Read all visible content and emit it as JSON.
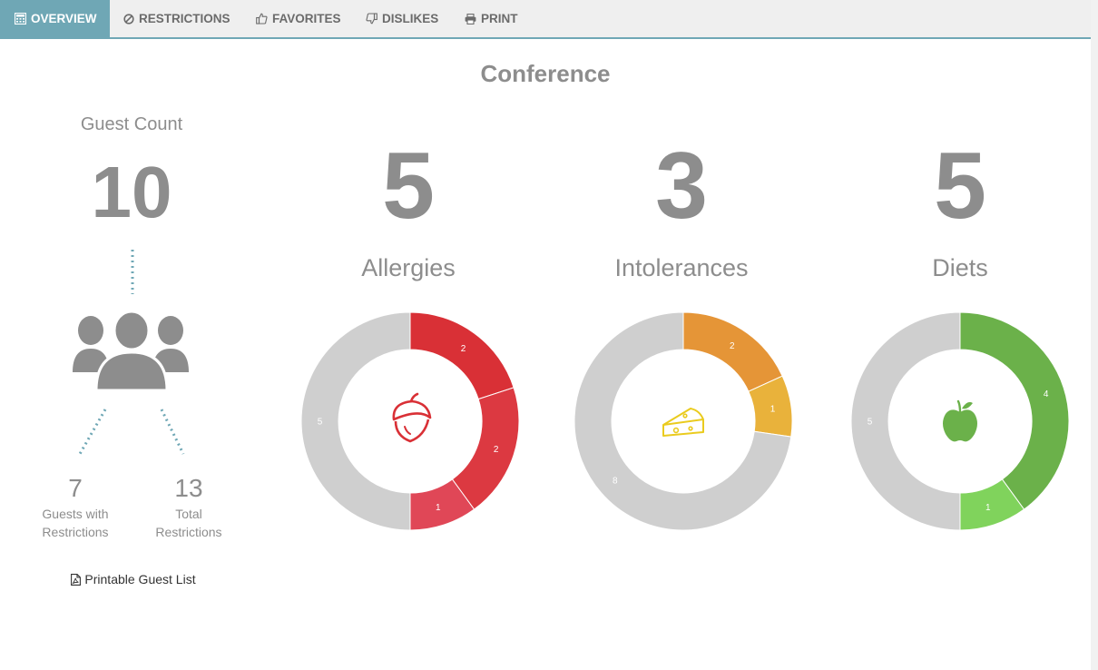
{
  "tabs": [
    {
      "label": "OVERVIEW",
      "icon": "calculator-icon",
      "active": true
    },
    {
      "label": "RESTRICTIONS",
      "icon": "ban-icon",
      "active": false
    },
    {
      "label": "FAVORITES",
      "icon": "thumbs-up-icon",
      "active": false
    },
    {
      "label": "DISLIKES",
      "icon": "thumbs-down-icon",
      "active": false
    },
    {
      "label": "PRINT",
      "icon": "printer-icon",
      "active": false
    }
  ],
  "title": "Conference",
  "guest": {
    "label": "Guest Count",
    "count": "10",
    "with_restrictions": {
      "value": "7",
      "label_line1": "Guests with",
      "label_line2": "Restrictions"
    },
    "total_restrictions": {
      "value": "13",
      "label_line1": "Total",
      "label_line2": "Restrictions"
    },
    "pdf_link": "Printable Guest List"
  },
  "colors": {
    "accent": "#6fa7b5",
    "gray_ring": "#cfcfcf",
    "text": "#8d8d8d"
  },
  "categories": [
    {
      "count": "5",
      "name": "Allergies",
      "icon": "acorn-icon",
      "icon_color": "#d93036"
    },
    {
      "count": "3",
      "name": "Intolerances",
      "icon": "cheese-icon",
      "icon_color": "#eacb1e"
    },
    {
      "count": "5",
      "name": "Diets",
      "icon": "apple-icon",
      "icon_color": "#6bb14a"
    }
  ],
  "chart_data": [
    {
      "type": "pie",
      "title": "Allergies",
      "values": [
        2,
        2,
        1,
        5
      ],
      "value_labels": [
        "2",
        "2",
        "1",
        "5"
      ],
      "colors": [
        "#d93036",
        "#dc3941",
        "#e04757",
        "#cfcfcf"
      ]
    },
    {
      "type": "pie",
      "title": "Intolerances",
      "values": [
        2,
        1,
        8
      ],
      "value_labels": [
        "2",
        "1",
        "8"
      ],
      "colors": [
        "#e59537",
        "#e9b23b",
        "#cfcfcf"
      ]
    },
    {
      "type": "pie",
      "title": "Diets",
      "values": [
        4,
        1,
        5
      ],
      "value_labels": [
        "4",
        "1",
        "5"
      ],
      "colors": [
        "#6bb14a",
        "#80d35c",
        "#cfcfcf"
      ]
    }
  ]
}
